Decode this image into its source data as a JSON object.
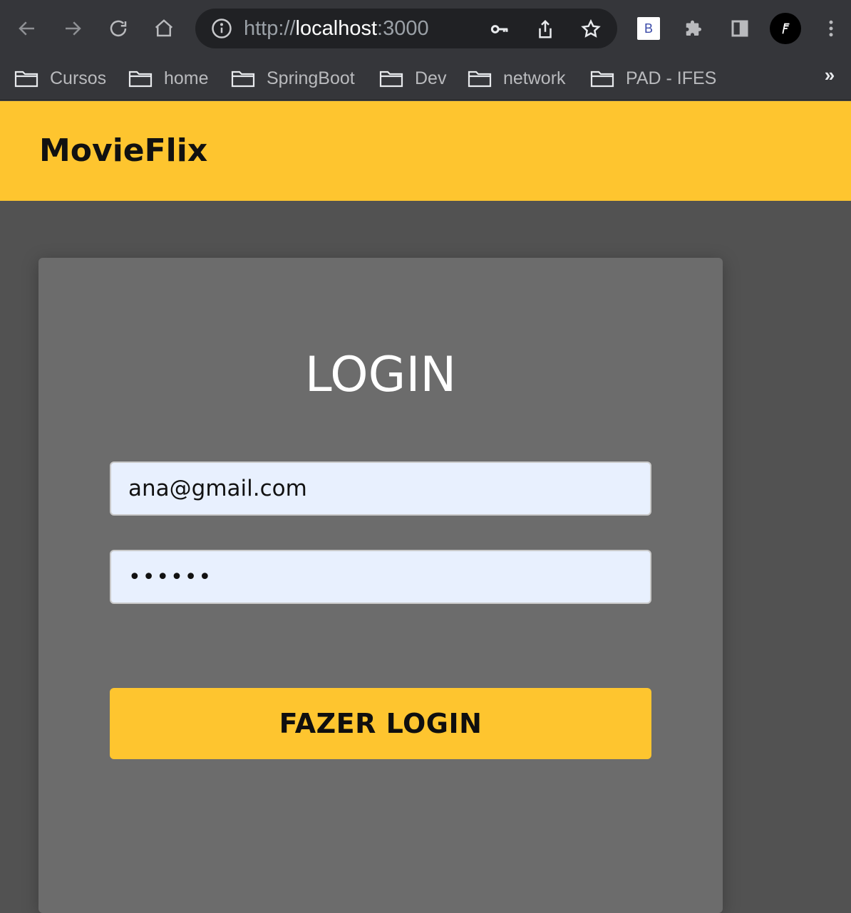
{
  "browser": {
    "url": {
      "scheme": "http://",
      "host": "localhost",
      "port": ":3000"
    },
    "extension_label": "B",
    "bookmarks": [
      {
        "label": "Cursos"
      },
      {
        "label": "home"
      },
      {
        "label": "SpringBoot"
      },
      {
        "label": "Dev"
      },
      {
        "label": "network"
      },
      {
        "label": "PAD - IFES"
      }
    ],
    "bookmarks_overflow": "»"
  },
  "app": {
    "brand": "MovieFlix",
    "accent_color": "#fec52f",
    "login": {
      "title": "LOGIN",
      "email_value": "ana@gmail.com",
      "password_value": "••••••",
      "submit_label": "FAZER LOGIN"
    }
  }
}
